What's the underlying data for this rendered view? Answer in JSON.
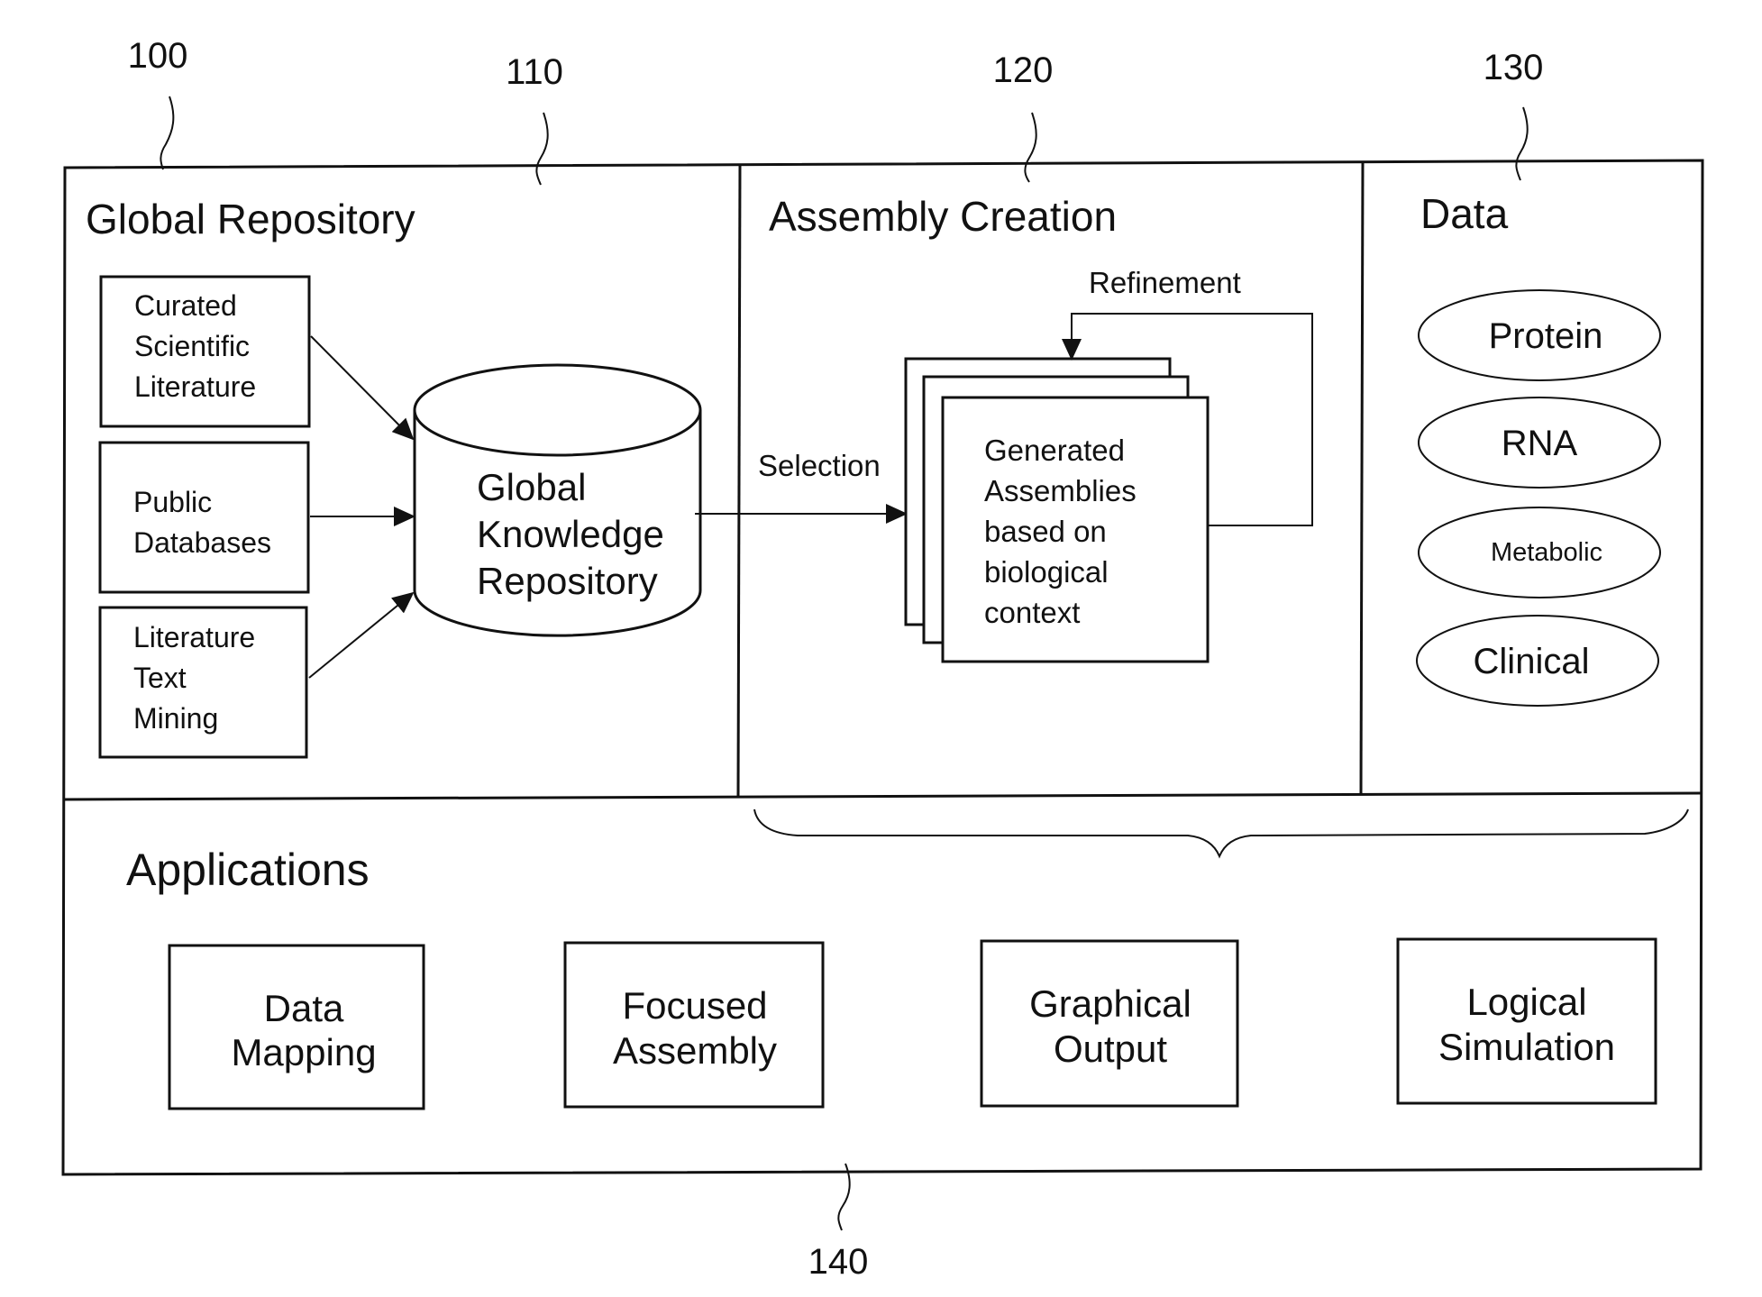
{
  "reference_numerals": {
    "system": "100",
    "global_repository": "110",
    "assembly_creation": "120",
    "data": "130",
    "applications": "140"
  },
  "global_repository": {
    "title": "Global Repository",
    "sources": [
      {
        "lines": [
          "Curated",
          "Scientific",
          "Literature"
        ]
      },
      {
        "lines": [
          "Public",
          "Databases"
        ]
      },
      {
        "lines": [
          "Literature",
          "Text",
          "Mining"
        ]
      }
    ],
    "repository": {
      "lines": [
        "Global",
        "Knowledge",
        "Repository"
      ]
    }
  },
  "assembly_creation": {
    "title": "Assembly Creation",
    "selection_label": "Selection",
    "refinement_label": "Refinement",
    "assemblies": {
      "lines": [
        "Generated",
        "Assemblies",
        "based on",
        "biological",
        "context"
      ]
    }
  },
  "data": {
    "title": "Data",
    "types": [
      "Protein",
      "RNA",
      "Metabolic",
      "Clinical"
    ]
  },
  "applications": {
    "title": "Applications",
    "items": [
      {
        "lines": [
          "Data",
          "Mapping"
        ]
      },
      {
        "lines": [
          "Focused",
          "Assembly"
        ]
      },
      {
        "lines": [
          "Graphical",
          "Output"
        ]
      },
      {
        "lines": [
          "Logical",
          "Simulation"
        ]
      }
    ]
  }
}
